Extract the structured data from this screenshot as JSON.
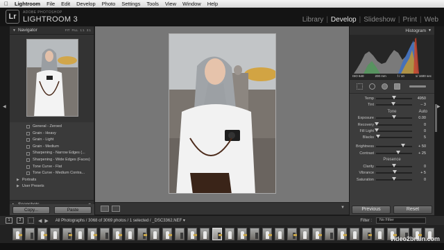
{
  "menubar": {
    "apple": "",
    "items": [
      "Lightroom",
      "File",
      "Edit",
      "Develop",
      "Photo",
      "Settings",
      "Tools",
      "View",
      "Window",
      "Help"
    ]
  },
  "identity": {
    "logo": "Lr",
    "top_text": "ADOBE PHOTOSHOP",
    "main_text": "LIGHTROOM 3"
  },
  "modules": {
    "items": [
      "Library",
      "Develop",
      "Slideshow",
      "Print",
      "Web"
    ],
    "active": "Develop",
    "separator": "|"
  },
  "left_panel": {
    "navigator_title": "Navigator",
    "zoom_options": [
      "FIT",
      "FILL",
      "1:1",
      "3:1"
    ],
    "presets": [
      {
        "label": "General - Zeroed",
        "kind": "preset"
      },
      {
        "label": "Grain - Heavy",
        "kind": "preset"
      },
      {
        "label": "Grain - Light",
        "kind": "preset"
      },
      {
        "label": "Grain - Medium",
        "kind": "preset"
      },
      {
        "label": "Sharpening - Narrow Edges (...",
        "kind": "preset"
      },
      {
        "label": "Sharpening - Wide Edges (Faces)",
        "kind": "preset"
      },
      {
        "label": "Tone Curve - Flat",
        "kind": "preset"
      },
      {
        "label": "Tone Curve - Medium Contra...",
        "kind": "preset"
      },
      {
        "label": "Portraits",
        "kind": "folder"
      },
      {
        "label": "User Presets",
        "kind": "folder"
      }
    ],
    "snapshots_title": "Snapshots",
    "copy_label": "Copy...",
    "paste_label": "Paste"
  },
  "right_panel": {
    "histogram_title": "Histogram",
    "hist_info": {
      "iso": "ISO 640",
      "focal": "200 mm",
      "aperture": "f / 10",
      "shutter": "1/ 1600 sec"
    },
    "wb_sliders": [
      {
        "label": "Temp",
        "value": "4950",
        "pos": 0.5
      },
      {
        "label": "Tint",
        "value": "– 3",
        "pos": 0.48
      }
    ],
    "tone_title": "Tone",
    "auto_label": "Auto",
    "tone_sliders": [
      {
        "label": "Exposure",
        "value": "0.00",
        "pos": 0.5
      },
      {
        "label": "Recovery",
        "value": "0",
        "pos": 0.02
      },
      {
        "label": "Fill Light",
        "value": "0",
        "pos": 0.02
      },
      {
        "label": "Blacks",
        "value": "5",
        "pos": 0.05
      }
    ],
    "tone_sliders2": [
      {
        "label": "Brightness",
        "value": "+ 50",
        "pos": 0.75
      },
      {
        "label": "Contrast",
        "value": "+ 25",
        "pos": 0.62
      }
    ],
    "presence_title": "Presence",
    "presence_sliders": [
      {
        "label": "Clarity",
        "value": "0",
        "pos": 0.5
      },
      {
        "label": "Vibrance",
        "value": "+ 5",
        "pos": 0.52
      },
      {
        "label": "Saturation",
        "value": "0",
        "pos": 0.5
      }
    ],
    "previous_label": "Previous",
    "reset_label": "Reset"
  },
  "filmstrip": {
    "page_buttons": [
      "1",
      "2"
    ],
    "path_text": "All Photographs / 3068 of 3069 photos / 1 selected / _DSC3362.NEF ▾",
    "filter_label": "Filter :",
    "filter_value": "No Filter",
    "thumb_count": 34,
    "selected_index": 16
  },
  "watermark": "video2brain.com"
}
